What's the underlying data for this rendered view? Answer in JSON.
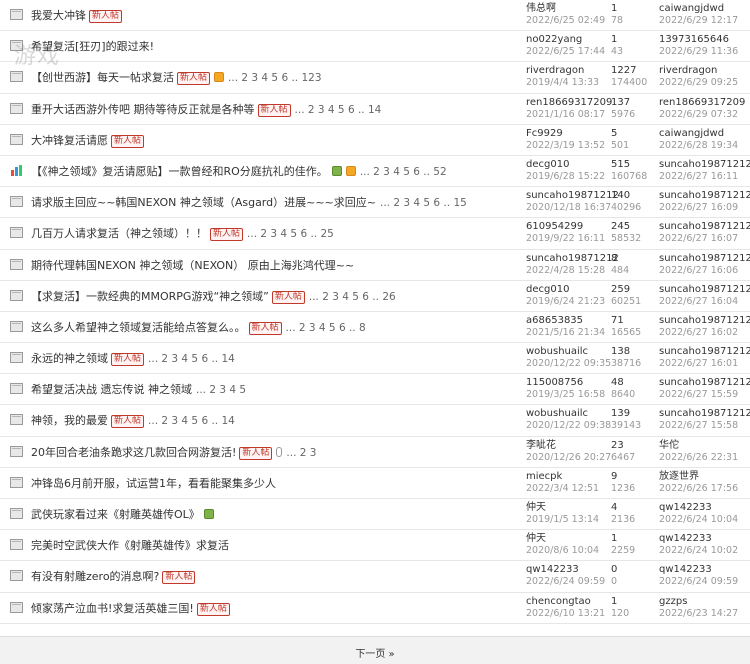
{
  "badge_text": "新人帖",
  "watermark": "游戏",
  "footer": {
    "next_label": "下一页 »"
  },
  "threads": [
    {
      "icon": "folder",
      "title": "我爱大冲锋",
      "badge": true,
      "extras": [],
      "pages": "",
      "author": "伟总啊",
      "author_date": "2022/6/25 02:49",
      "replies": "1",
      "views": "78",
      "last_user": "caiwangjdwd",
      "last_date": "2022/6/29 12:17"
    },
    {
      "icon": "folder",
      "title": "希望复活[狂刃]的跟过来!",
      "badge": false,
      "extras": [],
      "pages": "",
      "author": "no022yang",
      "author_date": "2022/6/25 17:44",
      "replies": "1",
      "views": "43",
      "last_user": "13973165646",
      "last_date": "2022/6/29 11:36"
    },
    {
      "icon": "folder",
      "title": "【创世西游】每天一帖求复活",
      "badge": true,
      "extras": [
        "hot"
      ],
      "pages": "... 2 3 4 5 6 .. 123",
      "author": "riverdragon",
      "author_date": "2019/4/4 13:33",
      "replies": "1227",
      "views": "174400",
      "last_user": "riverdragon",
      "last_date": "2022/6/29 09:25"
    },
    {
      "icon": "folder",
      "title": "重开大话西游外传吧 期待等待反正就是各种等",
      "badge": true,
      "extras": [],
      "pages": "... 2 3 4 5 6 .. 14",
      "author": "ren18669317209",
      "author_date": "2021/1/16 08:17",
      "replies": "137",
      "views": "5976",
      "last_user": "ren18669317209",
      "last_date": "2022/6/29 07:32"
    },
    {
      "icon": "folder",
      "title": "大冲锋复活请愿",
      "badge": true,
      "extras": [],
      "pages": "",
      "author": "Fc9929",
      "author_date": "2022/3/19 13:52",
      "replies": "5",
      "views": "501",
      "last_user": "caiwangjdwd",
      "last_date": "2022/6/28 19:34"
    },
    {
      "icon": "poll",
      "title": "【《神之领域》复活请愿贴】一款曾经和RO分庭抗礼的佳作。",
      "badge": false,
      "extras": [
        "img",
        "hot"
      ],
      "pages": "... 2 3 4 5 6 .. 52",
      "author": "decg010",
      "author_date": "2019/6/28 15:22",
      "replies": "515",
      "views": "160768",
      "last_user": "suncaho19871212",
      "last_date": "2022/6/27 16:11"
    },
    {
      "icon": "folder",
      "title": "请求版主回应~~韩国NEXON 神之领域（Asgard）进展~~~求回应~",
      "badge": false,
      "extras": [],
      "pages": "... 2 3 4 5 6 .. 15",
      "author": "suncaho19871212",
      "author_date": "2020/12/18 16:37",
      "replies": "140",
      "views": "40296",
      "last_user": "suncaho19871212",
      "last_date": "2022/6/27 16:09"
    },
    {
      "icon": "folder",
      "title": "几百万人请求复活（神之领域）！！",
      "badge": true,
      "extras": [],
      "pages": "... 2 3 4 5 6 .. 25",
      "author": "610954299",
      "author_date": "2019/9/22 16:11",
      "replies": "245",
      "views": "58532",
      "last_user": "suncaho19871212",
      "last_date": "2022/6/27 16:07"
    },
    {
      "icon": "folder",
      "title": "期待代理韩国NEXON 神之领域（NEXON） 原由上海兆鸿代理~~",
      "badge": false,
      "extras": [],
      "pages": "",
      "author": "suncaho19871212",
      "author_date": "2022/4/28 15:28",
      "replies": "8",
      "views": "484",
      "last_user": "suncaho19871212",
      "last_date": "2022/6/27 16:06"
    },
    {
      "icon": "folder",
      "title": "【求复活】一款经典的MMORPG游戏“神之领域”",
      "badge": true,
      "extras": [],
      "pages": "... 2 3 4 5 6 .. 26",
      "author": "decg010",
      "author_date": "2019/6/24 21:23",
      "replies": "259",
      "views": "60251",
      "last_user": "suncaho19871212",
      "last_date": "2022/6/27 16:04"
    },
    {
      "icon": "folder",
      "title": "这么多人希望神之领域复活能给点答复么。。",
      "badge": true,
      "extras": [],
      "pages": "... 2 3 4 5 6 .. 8",
      "author": "a68653835",
      "author_date": "2021/5/16 21:34",
      "replies": "71",
      "views": "16565",
      "last_user": "suncaho19871212",
      "last_date": "2022/6/27 16:02"
    },
    {
      "icon": "folder",
      "title": "永远的神之领域",
      "badge": true,
      "extras": [],
      "pages": "... 2 3 4 5 6 .. 14",
      "author": "wobushuailc",
      "author_date": "2020/12/22 09:35",
      "replies": "138",
      "views": "38716",
      "last_user": "suncaho19871212",
      "last_date": "2022/6/27 16:01"
    },
    {
      "icon": "folder",
      "title": "希望复活决战 遗忘传说 神之领域",
      "badge": false,
      "extras": [],
      "pages": "... 2 3 4 5",
      "author": "115008756",
      "author_date": "2019/3/25 16:58",
      "replies": "48",
      "views": "8640",
      "last_user": "suncaho19871212",
      "last_date": "2022/6/27 15:59"
    },
    {
      "icon": "folder",
      "title": "神领，我的最爱",
      "badge": true,
      "extras": [],
      "pages": "... 2 3 4 5 6 .. 14",
      "author": "wobushuailc",
      "author_date": "2020/12/22 09:38",
      "replies": "139",
      "views": "39143",
      "last_user": "suncaho19871212",
      "last_date": "2022/6/27 15:58"
    },
    {
      "icon": "folder",
      "title": "20年回合老油条跪求这几款回合网游复活!",
      "badge": true,
      "extras": [
        "clip"
      ],
      "pages": "... 2 3",
      "author": "李呲花",
      "author_date": "2020/12/26 20:27",
      "replies": "23",
      "views": "6467",
      "last_user": "华佗",
      "last_date": "2022/6/26 22:31"
    },
    {
      "icon": "folder",
      "title": "冲锋岛6月前开服，试运营1年，看看能聚集多少人",
      "badge": false,
      "extras": [],
      "pages": "",
      "author": "miecpk",
      "author_date": "2022/3/4 12:51",
      "replies": "9",
      "views": "1236",
      "last_user": "放逐世界",
      "last_date": "2022/6/26 17:56"
    },
    {
      "icon": "folder",
      "title": "武侠玩家看过来《射雕英雄传OL》",
      "badge": false,
      "extras": [
        "img"
      ],
      "pages": "",
      "author": "仲天",
      "author_date": "2019/1/5 13:14",
      "replies": "4",
      "views": "2136",
      "last_user": "qw142233",
      "last_date": "2022/6/24 10:04"
    },
    {
      "icon": "folder",
      "title": "完美时空武侠大作《射雕英雄传》求复活",
      "badge": false,
      "extras": [],
      "pages": "",
      "author": "仲天",
      "author_date": "2020/8/6 10:04",
      "replies": "1",
      "views": "2259",
      "last_user": "qw142233",
      "last_date": "2022/6/24 10:02"
    },
    {
      "icon": "folder",
      "title": "有没有射雕zero的消息啊?",
      "badge": true,
      "extras": [],
      "pages": "",
      "author": "qw142233",
      "author_date": "2022/6/24 09:59",
      "replies": "0",
      "views": "0",
      "last_user": "qw142233",
      "last_date": "2022/6/24 09:59"
    },
    {
      "icon": "folder",
      "title": "倾家荡产泣血书!求复活英雄三国!",
      "badge": true,
      "extras": [],
      "pages": "",
      "author": "chencongtao",
      "author_date": "2022/6/10 13:21",
      "replies": "1",
      "views": "120",
      "last_user": "gzzps",
      "last_date": "2022/6/23 14:27"
    }
  ]
}
